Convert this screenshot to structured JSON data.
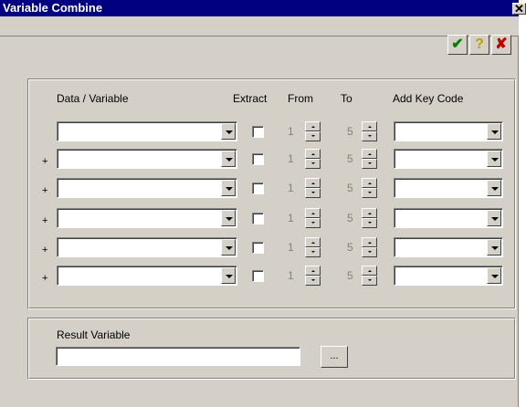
{
  "window": {
    "title": "Variable Combine",
    "close_glyph": "✕"
  },
  "toolbar": {
    "ok_icon": "checkmark-icon",
    "ok_glyph": "✔",
    "ok_color": "#008000",
    "help_icon": "question-icon",
    "help_glyph": "?",
    "help_color": "#c0a000",
    "cancel_icon": "x-icon",
    "cancel_glyph": "✘",
    "cancel_color": "#c00000"
  },
  "headers": {
    "data_variable": "Data / Variable",
    "extract": "Extract",
    "from": "From",
    "to": "To",
    "add_key_code": "Add Key Code"
  },
  "rows": [
    {
      "prefix": "",
      "variable": "",
      "extract": false,
      "from": "1",
      "to": "5",
      "key_code": ""
    },
    {
      "prefix": "+",
      "variable": "",
      "extract": false,
      "from": "1",
      "to": "5",
      "key_code": ""
    },
    {
      "prefix": "+",
      "variable": "",
      "extract": false,
      "from": "1",
      "to": "5",
      "key_code": ""
    },
    {
      "prefix": "+",
      "variable": "",
      "extract": false,
      "from": "1",
      "to": "5",
      "key_code": ""
    },
    {
      "prefix": "+",
      "variable": "",
      "extract": false,
      "from": "1",
      "to": "5",
      "key_code": ""
    },
    {
      "prefix": "+",
      "variable": "",
      "extract": false,
      "from": "1",
      "to": "5",
      "key_code": ""
    }
  ],
  "result": {
    "label": "Result Variable",
    "value": "",
    "browse_label": "..."
  }
}
